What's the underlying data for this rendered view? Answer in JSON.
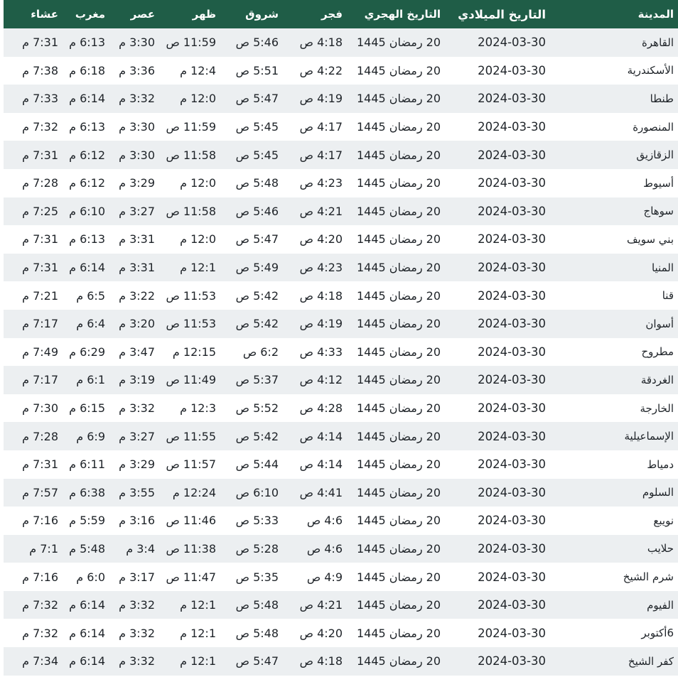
{
  "headers": {
    "city": "المدينة",
    "gregorian": "التاريخ الميلادي",
    "hijri": "التاريخ الهجري",
    "fajr": "فجر",
    "shuruq": "شروق",
    "dhuhr": "ظهر",
    "asr": "عصر",
    "maghrib": "مغرب",
    "isha": "عشاء"
  },
  "rows": [
    {
      "city": "القاهرة",
      "gregorian": "2024-03-30",
      "hijri": "20 رمضان 1445",
      "fajr": "4:18 ص",
      "shuruq": "5:46 ص",
      "dhuhr": "11:59 ص",
      "asr": "3:30 م",
      "maghrib": "6:13 م",
      "isha": "7:31 م"
    },
    {
      "city": "الأسكندرية",
      "gregorian": "2024-03-30",
      "hijri": "20 رمضان 1445",
      "fajr": "4:22 ص",
      "shuruq": "5:51 ص",
      "dhuhr": "12:4 م",
      "asr": "3:36 م",
      "maghrib": "6:18 م",
      "isha": "7:38 م"
    },
    {
      "city": "طنطا",
      "gregorian": "2024-03-30",
      "hijri": "20 رمضان 1445",
      "fajr": "4:19 ص",
      "shuruq": "5:47 ص",
      "dhuhr": "12:0 م",
      "asr": "3:32 م",
      "maghrib": "6:14 م",
      "isha": "7:33 م"
    },
    {
      "city": "المنصورة",
      "gregorian": "2024-03-30",
      "hijri": "20 رمضان 1445",
      "fajr": "4:17 ص",
      "shuruq": "5:45 ص",
      "dhuhr": "11:59 ص",
      "asr": "3:30 م",
      "maghrib": "6:13 م",
      "isha": "7:32 م"
    },
    {
      "city": "الزقازيق",
      "gregorian": "2024-03-30",
      "hijri": "20 رمضان 1445",
      "fajr": "4:17 ص",
      "shuruq": "5:45 ص",
      "dhuhr": "11:58 ص",
      "asr": "3:30 م",
      "maghrib": "6:12 م",
      "isha": "7:31 م"
    },
    {
      "city": "أسيوط",
      "gregorian": "2024-03-30",
      "hijri": "20 رمضان 1445",
      "fajr": "4:23 ص",
      "shuruq": "5:48 ص",
      "dhuhr": "12:0 م",
      "asr": "3:29 م",
      "maghrib": "6:12 م",
      "isha": "7:28 م"
    },
    {
      "city": "سوهاج",
      "gregorian": "2024-03-30",
      "hijri": "20 رمضان 1445",
      "fajr": "4:21 ص",
      "shuruq": "5:46 ص",
      "dhuhr": "11:58 ص",
      "asr": "3:27 م",
      "maghrib": "6:10 م",
      "isha": "7:25 م"
    },
    {
      "city": "بني سويف",
      "gregorian": "2024-03-30",
      "hijri": "20 رمضان 1445",
      "fajr": "4:20 ص",
      "shuruq": "5:47 ص",
      "dhuhr": "12:0 م",
      "asr": "3:31 م",
      "maghrib": "6:13 م",
      "isha": "7:31 م"
    },
    {
      "city": "المنيا",
      "gregorian": "2024-03-30",
      "hijri": "20 رمضان 1445",
      "fajr": "4:23 ص",
      "shuruq": "5:49 ص",
      "dhuhr": "12:1 م",
      "asr": "3:31 م",
      "maghrib": "6:14 م",
      "isha": "7:31 م"
    },
    {
      "city": "قنا",
      "gregorian": "2024-03-30",
      "hijri": "20 رمضان 1445",
      "fajr": "4:18 ص",
      "shuruq": "5:42 ص",
      "dhuhr": "11:53 ص",
      "asr": "3:22 م",
      "maghrib": "6:5 م",
      "isha": "7:21 م"
    },
    {
      "city": "أسوان",
      "gregorian": "2024-03-30",
      "hijri": "20 رمضان 1445",
      "fajr": "4:19 ص",
      "shuruq": "5:42 ص",
      "dhuhr": "11:53 ص",
      "asr": "3:20 م",
      "maghrib": "6:4 م",
      "isha": "7:17 م"
    },
    {
      "city": "مطروح",
      "gregorian": "2024-03-30",
      "hijri": "20 رمضان 1445",
      "fajr": "4:33 ص",
      "shuruq": "6:2 ص",
      "dhuhr": "12:15 م",
      "asr": "3:47 م",
      "maghrib": "6:29 م",
      "isha": "7:49 م"
    },
    {
      "city": "الغردقة",
      "gregorian": "2024-03-30",
      "hijri": "20 رمضان 1445",
      "fajr": "4:12 ص",
      "shuruq": "5:37 ص",
      "dhuhr": "11:49 ص",
      "asr": "3:19 م",
      "maghrib": "6:1 م",
      "isha": "7:17 م"
    },
    {
      "city": "الخارجة",
      "gregorian": "2024-03-30",
      "hijri": "20 رمضان 1445",
      "fajr": "4:28 ص",
      "shuruq": "5:52 ص",
      "dhuhr": "12:3 م",
      "asr": "3:32 م",
      "maghrib": "6:15 م",
      "isha": "7:30 م"
    },
    {
      "city": "الإسماعيلية",
      "gregorian": "2024-03-30",
      "hijri": "20 رمضان 1445",
      "fajr": "4:14 ص",
      "shuruq": "5:42 ص",
      "dhuhr": "11:55 ص",
      "asr": "3:27 م",
      "maghrib": "6:9 م",
      "isha": "7:28 م"
    },
    {
      "city": "دمياط",
      "gregorian": "2024-03-30",
      "hijri": "20 رمضان 1445",
      "fajr": "4:14 ص",
      "shuruq": "5:44 ص",
      "dhuhr": "11:57 ص",
      "asr": "3:29 م",
      "maghrib": "6:11 م",
      "isha": "7:31 م"
    },
    {
      "city": "السلوم",
      "gregorian": "2024-03-30",
      "hijri": "20 رمضان 1445",
      "fajr": "4:41 ص",
      "shuruq": "6:10 ص",
      "dhuhr": "12:24 م",
      "asr": "3:55 م",
      "maghrib": "6:38 م",
      "isha": "7:57 م"
    },
    {
      "city": "نويبع",
      "gregorian": "2024-03-30",
      "hijri": "20 رمضان 1445",
      "fajr": "4:6 ص",
      "shuruq": "5:33 ص",
      "dhuhr": "11:46 ص",
      "asr": "3:16 م",
      "maghrib": "5:59 م",
      "isha": "7:16 م"
    },
    {
      "city": "حلايب",
      "gregorian": "2024-03-30",
      "hijri": "20 رمضان 1445",
      "fajr": "4:6 ص",
      "shuruq": "5:28 ص",
      "dhuhr": "11:38 ص",
      "asr": "3:4 م",
      "maghrib": "5:48 م",
      "isha": "7:1 م"
    },
    {
      "city": "شرم الشيخ",
      "gregorian": "2024-03-30",
      "hijri": "20 رمضان 1445",
      "fajr": "4:9 ص",
      "shuruq": "5:35 ص",
      "dhuhr": "11:47 ص",
      "asr": "3:17 م",
      "maghrib": "6:0 م",
      "isha": "7:16 م"
    },
    {
      "city": "الفيوم",
      "gregorian": "2024-03-30",
      "hijri": "20 رمضان 1445",
      "fajr": "4:21 ص",
      "shuruq": "5:48 ص",
      "dhuhr": "12:1 م",
      "asr": "3:32 م",
      "maghrib": "6:14 م",
      "isha": "7:32 م"
    },
    {
      "city": "6أكتوبر",
      "gregorian": "2024-03-30",
      "hijri": "20 رمضان 1445",
      "fajr": "4:20 ص",
      "shuruq": "5:48 ص",
      "dhuhr": "12:1 م",
      "asr": "3:32 م",
      "maghrib": "6:14 م",
      "isha": "7:32 م"
    },
    {
      "city": "كفر الشيخ",
      "gregorian": "2024-03-30",
      "hijri": "20 رمضان 1445",
      "fajr": "4:18 ص",
      "shuruq": "5:47 ص",
      "dhuhr": "12:1 م",
      "asr": "3:32 م",
      "maghrib": "6:14 م",
      "isha": "7:34 م"
    }
  ],
  "colors": {
    "header_bg": "#1f5d47",
    "header_text": "#ffffff",
    "row_alt_bg": "#eceff1",
    "row_bg": "#ffffff",
    "body_text": "#1e2328"
  }
}
